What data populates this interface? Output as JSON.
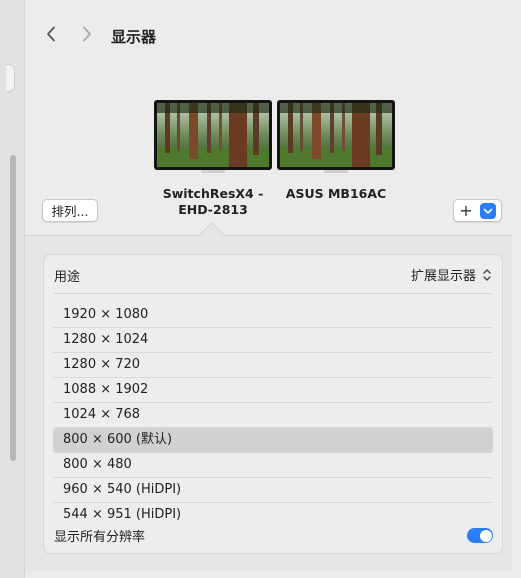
{
  "window": {
    "title": "显示器"
  },
  "displays": [
    {
      "name": "SwitchResX4 -\nEHD-2813"
    },
    {
      "name": "ASUS MB16AC"
    }
  ],
  "toolbar": {
    "arrange_label": "排列...",
    "add_label": "+"
  },
  "settings": {
    "usage_label": "用途",
    "usage_value": "扩展显示器",
    "resolutions": [
      "1920 × 1080",
      "1280 × 1024",
      "1280 × 720",
      "1088 × 1902",
      "1024 × 768",
      "800 × 600 (默认)",
      "800 × 480",
      "960 × 540 (HiDPI)",
      "544 × 951 (HiDPI)"
    ],
    "selected_resolution": "800 × 600 (默认)",
    "show_all_label": "显示所有分辨率",
    "show_all_enabled": true
  },
  "icons": {
    "back": "chevron-left-icon",
    "forward": "chevron-right-icon",
    "add": "plus-icon",
    "dropdown": "chevron-down-icon",
    "stepper": "up-down-chevron-icon"
  },
  "colors": {
    "accent": "#2b7cf6"
  }
}
